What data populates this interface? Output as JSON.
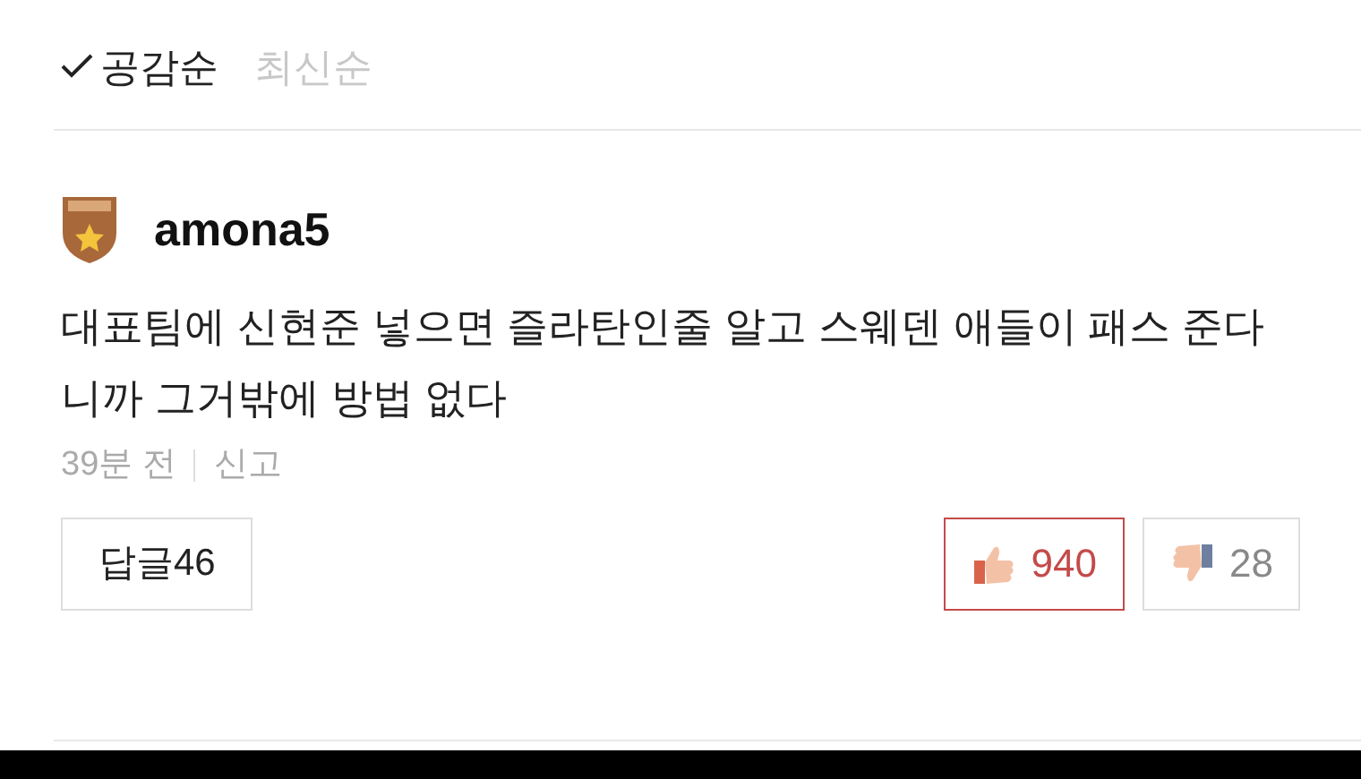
{
  "sort_options": [
    {
      "label": "공감순",
      "selected": true
    },
    {
      "label": "최신순",
      "selected": false
    }
  ],
  "comment": {
    "author": "amona5",
    "text": "대표팀에 신현준 넣으면 즐라탄인줄 알고 스웨덴 애들이 패스 준다니까 그거밖에 방법 없다",
    "time": "39분 전",
    "report": "신고",
    "replies_button": "답글46",
    "votes": [
      {
        "kind": "like",
        "count": "940",
        "selected": true
      },
      {
        "kind": "dislike",
        "count": "28",
        "selected": false
      }
    ]
  }
}
